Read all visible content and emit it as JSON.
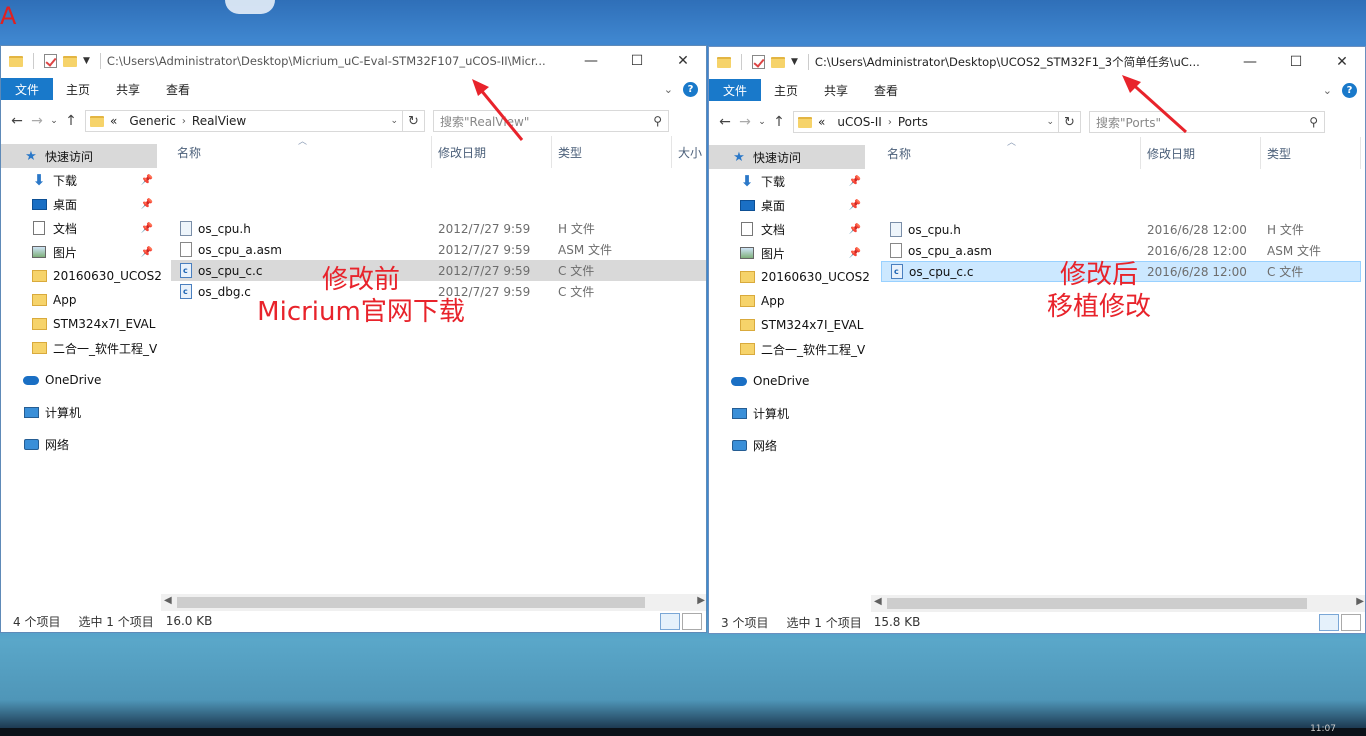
{
  "desktop": {
    "corner_letter": "A",
    "clock": "11:07"
  },
  "left_window": {
    "title_path": "C:\\Users\\Administrator\\Desktop\\Micrium_uC-Eval-STM32F107_uCOS-II\\Micr...",
    "ribbon_tabs": [
      "文件",
      "主页",
      "共享",
      "查看"
    ],
    "breadcrumb": [
      "Generic",
      "RealView"
    ],
    "breadcrumb_prefix": "«",
    "search_placeholder": "搜索\"RealView\"",
    "nav": {
      "quick_access": "快速访问",
      "pinned": [
        "下载",
        "桌面",
        "文档",
        "图片"
      ],
      "folders": [
        "20160630_UCOS2",
        "App",
        "STM324x7I_EVAL",
        "二合一_软件工程_V"
      ],
      "onedrive": "OneDrive",
      "computer": "计算机",
      "network": "网络"
    },
    "columns": {
      "name": "名称",
      "date": "修改日期",
      "type": "类型",
      "size": "大小"
    },
    "files": [
      {
        "name": "os_cpu.h",
        "date": "2012/7/27 9:59",
        "type": "H 文件",
        "icon": "h-file-icon"
      },
      {
        "name": "os_cpu_a.asm",
        "date": "2012/7/27 9:59",
        "type": "ASM 文件",
        "icon": "asm-file-icon"
      },
      {
        "name": "os_cpu_c.c",
        "date": "2012/7/27 9:59",
        "type": "C 文件",
        "icon": "c-file-icon",
        "selected": true
      },
      {
        "name": "os_dbg.c",
        "date": "2012/7/27 9:59",
        "type": "C 文件",
        "icon": "c-file-icon"
      }
    ],
    "annotation": [
      "修改前",
      "Micrium官网下载"
    ],
    "status": {
      "count": "4 个项目",
      "selected": "选中 1 个项目",
      "size": "16.0 KB"
    }
  },
  "right_window": {
    "title_path": "C:\\Users\\Administrator\\Desktop\\UCOS2_STM32F1_3个简单任务\\uC...",
    "ribbon_tabs": [
      "文件",
      "主页",
      "共享",
      "查看"
    ],
    "breadcrumb": [
      "uCOS-II",
      "Ports"
    ],
    "breadcrumb_prefix": "«",
    "search_placeholder": "搜索\"Ports\"",
    "nav": {
      "quick_access": "快速访问",
      "pinned": [
        "下载",
        "桌面",
        "文档",
        "图片"
      ],
      "folders": [
        "20160630_UCOS2",
        "App",
        "STM324x7I_EVAL",
        "二合一_软件工程_V"
      ],
      "onedrive": "OneDrive",
      "computer": "计算机",
      "network": "网络"
    },
    "columns": {
      "name": "名称",
      "date": "修改日期",
      "type": "类型"
    },
    "files": [
      {
        "name": "os_cpu.h",
        "date": "2016/6/28 12:00",
        "type": "H 文件",
        "icon": "h-file-icon"
      },
      {
        "name": "os_cpu_a.asm",
        "date": "2016/6/28 12:00",
        "type": "ASM 文件",
        "icon": "asm-file-icon"
      },
      {
        "name": "os_cpu_c.c",
        "date": "2016/6/28 12:00",
        "type": "C 文件",
        "icon": "c-file-icon",
        "selected": true
      }
    ],
    "annotation": [
      "修改后",
      "移植修改"
    ],
    "status": {
      "count": "3 个项目",
      "selected": "选中 1 个项目",
      "size": "15.8 KB"
    }
  },
  "colors": {
    "accent": "#1979ca",
    "annotation": "#e8232b",
    "selection_blue": "#cce8ff"
  }
}
